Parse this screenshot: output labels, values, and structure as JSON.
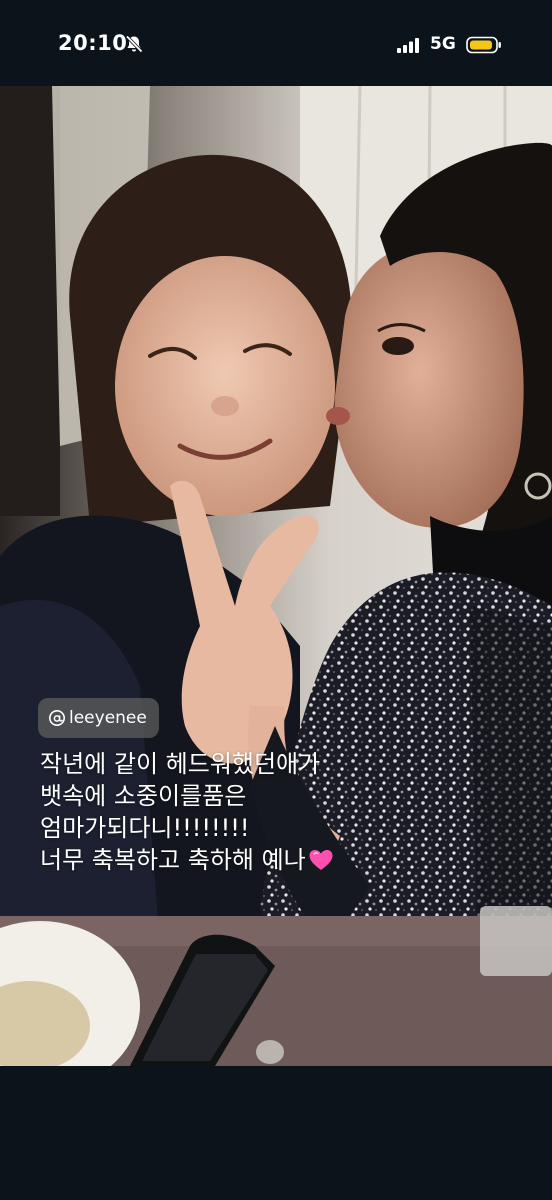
{
  "status_bar": {
    "time": "20:10",
    "network": "5G",
    "icons": [
      "bell-muted-icon",
      "signal-bars-icon",
      "battery-icon"
    ],
    "battery_color": "#f5c518"
  },
  "story": {
    "mention": {
      "icon": "threads-at-icon",
      "handle": "leeyenee"
    },
    "caption": {
      "lines": [
        "작년에 같이 헤드워했던애가",
        "뱃속에 소중이를품은",
        "엄마가되다니!!!!!!!!",
        "너무 축복하고 축하해 예나"
      ],
      "emoji": "pink-heart-icon",
      "emoji_color": "#ff4fb0"
    }
  }
}
